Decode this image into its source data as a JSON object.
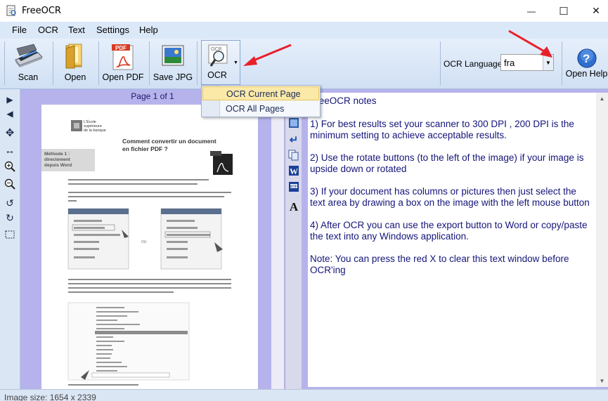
{
  "window": {
    "title": "FreeOCR",
    "minimize_glyph": "—",
    "maximize_glyph": "☐",
    "close_glyph": "✕"
  },
  "menu": [
    "File",
    "OCR",
    "Text",
    "Settings",
    "Help"
  ],
  "toolbar": {
    "scan_label": "Scan",
    "open_label": "Open",
    "open_pdf_label": "Open PDF",
    "save_jpg_label": "Save JPG",
    "ocr_label": "OCR",
    "ocr_language_label": "OCR Language:",
    "ocr_language_value": "fra",
    "open_help_label": "Open Help",
    "icons": {
      "scan": "scanner-icon",
      "open": "folder-icon",
      "open_pdf": "pdf-icon",
      "save_jpg": "image-icon",
      "ocr": "magnifier-icon",
      "help": "help-icon"
    }
  },
  "ocr_dropdown": {
    "items": [
      "OCR Current Page",
      "OCR All Pages"
    ],
    "highlighted": "OCR Current Page"
  },
  "image_pane": {
    "page_indicator": "Page 1 of 1",
    "document": {
      "logo_line1": "L'École",
      "logo_line2": "supérieure",
      "logo_line3": "de la banque",
      "heading_line1": "Comment convertir un document",
      "heading_line2": "en fichier PDF ?",
      "method_line1": "Méthode 1 :",
      "method_line2": "directement",
      "method_line3": "depuis Word"
    }
  },
  "text_pane": {
    "paragraphs": [
      "FreeOCR notes",
      "1) For best results set your scanner to 300 DPI , 200 DPI is the minimum setting to achieve acceptable results.",
      "2) Use the rotate buttons (to the left of the image) if your image is upside down or rotated",
      "3) If your document has columns or pictures then just select the text area by drawing a box on the image with the left mouse button",
      "4) After OCR you can use the export button to Word or copy/paste the text into any Windows application.",
      "Note: You can press the red X to clear this text window before OCR'ing"
    ]
  },
  "status": {
    "text": "Image size:  1654 x  2339"
  },
  "colors": {
    "accent_red": "#e8202a",
    "text_blue": "#15157a",
    "pane_lavender": "#b6b3ec"
  }
}
